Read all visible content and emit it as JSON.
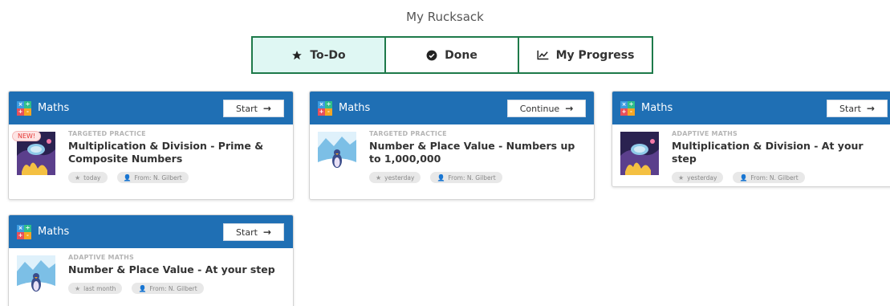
{
  "page": {
    "title": "My Rucksack"
  },
  "tabs": [
    {
      "label": "To-Do",
      "icon": "star-icon",
      "active": true
    },
    {
      "label": "Done",
      "icon": "check-circle-icon",
      "active": false
    },
    {
      "label": "My Progress",
      "icon": "chart-line-icon",
      "active": false
    }
  ],
  "subject_icon_symbols": [
    "×",
    "÷",
    "+",
    "-"
  ],
  "cards": [
    {
      "subject": "Maths",
      "button": "Start",
      "new_badge": "NEW!",
      "kind": "TARGETED PRACTICE",
      "title": "Multiplication & Division - Prime & Composite Numbers",
      "when": "today",
      "from": "From: N. Gilbert"
    },
    {
      "subject": "Maths",
      "button": "Continue",
      "kind": "TARGETED PRACTICE",
      "title": "Number & Place Value - Numbers up to 1,000,000",
      "when": "yesterday",
      "from": "From: N. Gilbert"
    },
    {
      "subject": "Maths",
      "button": "Start",
      "kind": "ADAPTIVE MATHS",
      "title": "Multiplication & Division - At your step",
      "when": "yesterday",
      "from": "From: N. Gilbert"
    },
    {
      "subject": "Maths",
      "button": "Start",
      "kind": "ADAPTIVE MATHS",
      "title": "Number & Place Value - At your step",
      "when": "last month",
      "from": "From: N. Gilbert"
    }
  ],
  "colors": {
    "header_blue": "#1f6fb4",
    "tab_border": "#1e7a4a",
    "tab_active_bg": "#dff7f3",
    "new_badge": "#e53935"
  }
}
